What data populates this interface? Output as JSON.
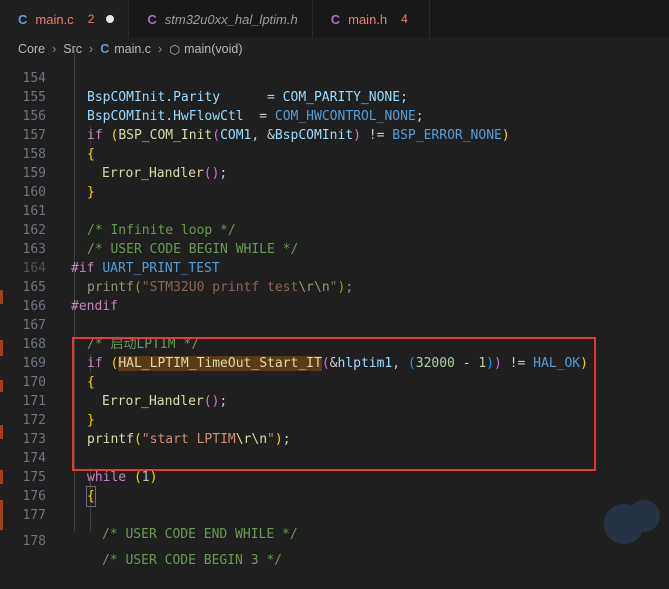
{
  "tabs": [
    {
      "label": "main.c",
      "icon": "C",
      "badge": "2",
      "modified": true,
      "active": true
    },
    {
      "label": "stm32u0xx_hal_lptim.h",
      "icon": "C",
      "active": false
    },
    {
      "label": "main.h",
      "icon": "C",
      "badge": "4",
      "active": false
    }
  ],
  "breadcrumb": {
    "core": "Core",
    "src": "Src",
    "file": "main.c",
    "symbol": "main(void)"
  },
  "line_numbers": [
    "154",
    "155",
    "156",
    "157",
    "158",
    "159",
    "160",
    "161",
    "162",
    "163",
    "164",
    "165",
    "166",
    "167",
    "168",
    "169",
    "170",
    "171",
    "172",
    "173",
    "174",
    "175",
    "176",
    "177",
    "178"
  ],
  "code": {
    "l154": "BspCOMInit.Parity      = COM_PARITY_NONE;",
    "l155a": "BspCOMInit",
    "l155b": ".",
    "l155c": "HwFlowCtl",
    "l155d": "  = ",
    "l155e": "COM_HWCONTROL_NONE",
    "l155f": ";",
    "l156_if": "if",
    "l156_fn": "BSP_COM_Init",
    "l156_com": "COM1",
    "l156_amp": ", &",
    "l156_var": "BspCOMInit",
    "l156_ne": " != ",
    "l156_err": "BSP_ERROR_NONE",
    "l157": "{",
    "l158_fn": "Error_Handler",
    "l158_end": ";",
    "l159": "}",
    "l161": "/* Infinite loop */",
    "l162": "/* USER CODE BEGIN WHILE */",
    "l163_kw": "#if",
    "l163_macro": "UART_PRINT_TEST",
    "l164_fn": "printf",
    "l164_str": "\"STM32U0 printf test",
    "l164_esc": "\\r\\n",
    "l164_q": "\"",
    "l164_end": ";",
    "l165": "#endif",
    "l167": "/* 启动LPTIM */",
    "l168_if": "if",
    "l168_fn": "HAL_LPTIM_TimeOut_Start_IT",
    "l168_amp": "&",
    "l168_var": "hlptim1",
    "l168_comma": ", ",
    "l168_n1": "32000",
    "l168_minus": " - ",
    "l168_n2": "1",
    "l168_ne": " != ",
    "l168_ok": "HAL_OK",
    "l169": "{",
    "l170_fn": "Error_Handler",
    "l170_end": ";",
    "l171": "}",
    "l172_fn": "printf",
    "l172_str": "\"start LPTIM",
    "l172_esc": "\\r\\n",
    "l172_q": "\"",
    "l172_end": ";",
    "l174_kw": "while",
    "l174_n": "1",
    "l175": "{",
    "l177": "/* USER CODE END WHILE */",
    "l178": "/* USER CODE BEGIN 3 */"
  },
  "colors": {
    "keyword": "#569cd6",
    "preproc": "#c586c0",
    "function": "#dcdcaa",
    "variable": "#9cdcfe",
    "constant": "#4ec9b0",
    "comment": "#6a9955",
    "string": "#ce9178",
    "number": "#b5cea8",
    "highlight_box": "#e53935"
  }
}
